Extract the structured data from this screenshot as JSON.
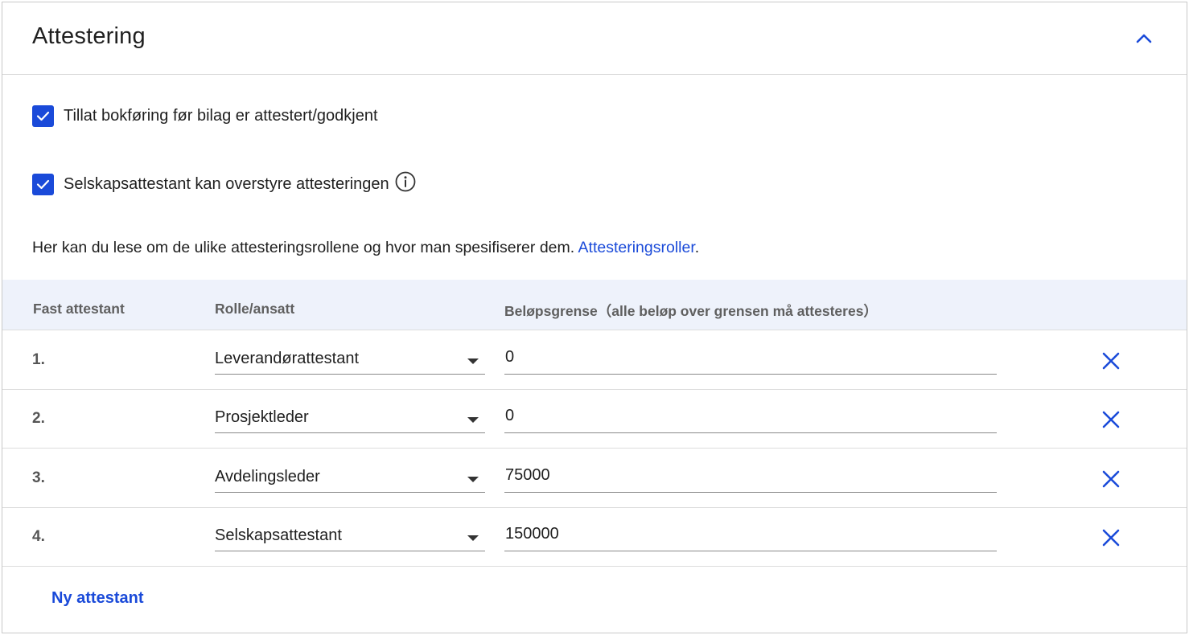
{
  "panel": {
    "title": "Attestering"
  },
  "options": [
    {
      "label": "Tillat bokføring før bilag er attestert/godkjent",
      "checked": true
    },
    {
      "label": "Selskapsattestant kan overstyre attesteringen",
      "checked": true,
      "icon": "info-icon"
    }
  ],
  "intro": {
    "text": "Her kan du lese om de ulike attesteringsrollene og hvor man spesifiserer dem. ",
    "link": "Attesteringsroller",
    "suffix": "."
  },
  "table": {
    "headers": {
      "col1": "Fast attestant",
      "col2": "Rolle/ansatt",
      "col3": "Beløpsgrense（alle beløp over grensen må attesteres）"
    },
    "rows": [
      {
        "num": "1.",
        "role": "Leverandørattestant",
        "amount": "0"
      },
      {
        "num": "2.",
        "role": "Prosjektleder",
        "amount": "0"
      },
      {
        "num": "3.",
        "role": "Avdelingsleder",
        "amount": "75000"
      },
      {
        "num": "4.",
        "role": "Selskapsattestant",
        "amount": "150000"
      }
    ]
  },
  "actions": {
    "add_label": "Ny attestant"
  },
  "colors": {
    "accent": "#1a4ad9",
    "header_bg": "#eef2fb"
  }
}
